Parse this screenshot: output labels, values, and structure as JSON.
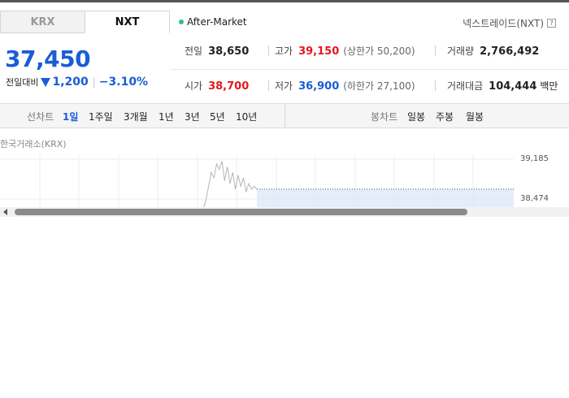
{
  "tabs": [
    {
      "label": "KRX",
      "active": false
    },
    {
      "label": "NXT",
      "active": true
    }
  ],
  "session": {
    "label": "After-Market",
    "dot_color": "#2ec27e"
  },
  "provider": {
    "label": "넥스트레이드(NXT)",
    "help_icon": "?"
  },
  "price": {
    "current": "37,450",
    "change_label": "전일대비",
    "change_direction": "down",
    "change_value": "1,200",
    "change_percent": "−3.10%",
    "color": "#1a5dd6"
  },
  "stats": {
    "prev_close": {
      "label": "전일",
      "value": "38,650"
    },
    "high": {
      "label": "고가",
      "value": "39,150",
      "sub": "(상한가 50,200)"
    },
    "volume": {
      "label": "거래량",
      "value": "2,766,492"
    },
    "open": {
      "label": "시가",
      "value": "38,700"
    },
    "low": {
      "label": "저가",
      "value": "36,900",
      "sub": "(하한가 27,100)"
    },
    "turnover": {
      "label": "거래대금",
      "value": "104,444",
      "unit": "백만"
    }
  },
  "toolbar": {
    "line_chart_title": "선차트",
    "periods": [
      "1일",
      "1주일",
      "3개월",
      "1년",
      "3년",
      "5년",
      "10년"
    ],
    "active_period": "1일",
    "candle_chart_title": "봉차트",
    "candle_periods": [
      "일봉",
      "주봉",
      "월봉"
    ]
  },
  "chart": {
    "label": "한국거래소(KRX)",
    "y_labels": [
      "39,185",
      "38,474"
    ]
  },
  "chart_data": {
    "type": "line",
    "title": "",
    "y_tick_labels": [
      "39,185",
      "38,474"
    ],
    "reference_line": 38650,
    "series": [
      {
        "values": [
          38300,
          38450,
          38700,
          38950,
          38850,
          39100,
          39000,
          39150,
          38800,
          39050,
          38750,
          38950,
          38650,
          38900,
          38700,
          38850,
          38600,
          38750,
          38650,
          38700,
          38650
        ]
      }
    ],
    "grid": true
  },
  "colors": {
    "up": "#e0191f",
    "down": "#1a5dd6",
    "line": "#b5b5b5",
    "band": "#dde9f7"
  }
}
